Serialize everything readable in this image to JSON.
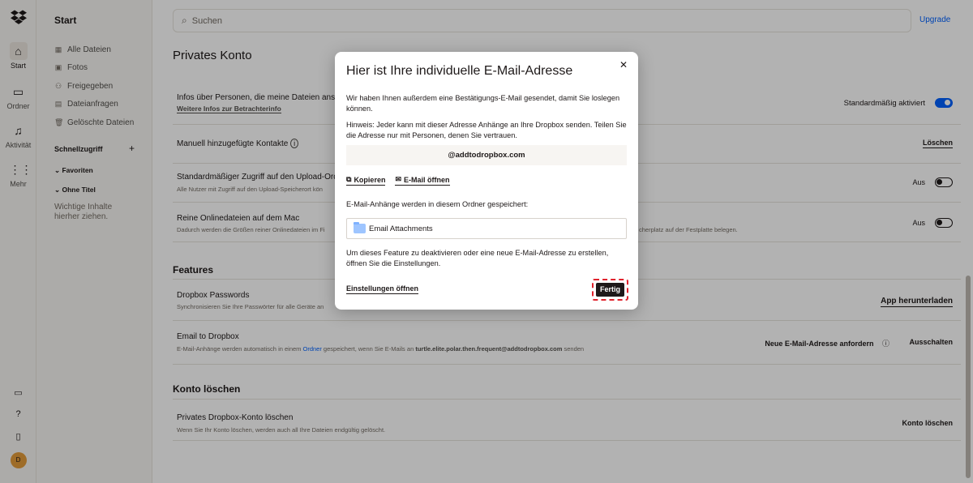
{
  "rail": {
    "items": [
      {
        "label": "Start"
      },
      {
        "label": "Ordner"
      },
      {
        "label": "Aktivität"
      },
      {
        "label": "Mehr"
      }
    ],
    "avatar": "D"
  },
  "sidebar": {
    "title": "Start",
    "items": [
      "Alle Dateien",
      "Fotos",
      "Freigegeben",
      "Dateianfragen",
      "Gelöschte Dateien"
    ],
    "quick_access": "Schnellzugriff",
    "favorites": "Favoriten",
    "untitled": "Ohne Titel",
    "drop_hint_1": "Wichtige Inhalte",
    "drop_hint_2": "hierher ziehen."
  },
  "search": {
    "placeholder": "Suchen"
  },
  "upgrade": "Upgrade",
  "main": {
    "title": "Privates Konto",
    "rows": [
      {
        "title": "Infos über Personen, die meine Dateien anseh",
        "link": "Weitere Infos zur Betrachterinfo",
        "right": "Standardmäßig aktiviert"
      },
      {
        "title": "Manuell hinzugefügte Kontakte",
        "right": "Löschen"
      },
      {
        "title": "Standardmäßiger Zugriff auf den Upload-Ordn",
        "sub": "Alle Nutzer mit Zugriff auf den Upload-Speicherort kön",
        "right": "Aus"
      },
      {
        "title": "Reine Onlinedateien auf dem Mac",
        "sub": "Dadurch werden die Größen reiner Onlinedateien im Fi",
        "sub_right": "cherplatz auf der Festplatte belegen.",
        "right": "Aus"
      }
    ],
    "features_heading": "Features",
    "passwords": {
      "title": "Dropbox Passwords",
      "sub": "Synchronisieren Sie Ihre Passwörter für alle Geräte an",
      "right": "App herunterladen"
    },
    "email": {
      "title": "Email to Dropbox",
      "sub_prefix": "E-Mail-Anhänge werden automatisch in einem ",
      "sub_link": "Ordner",
      "sub_mid": " gespeichert, wenn Sie E-Mails an ",
      "sub_addr": "turtle.elite.polar.then.frequent@addtodropbox.com",
      "sub_suffix": " senden",
      "action1": "Neue E-Mail-Adresse anfordern",
      "action2": "Ausschalten"
    },
    "delete_heading": "Konto löschen",
    "delete": {
      "title": "Privates Dropbox-Konto löschen",
      "sub": "Wenn Sie Ihr Konto löschen, werden auch all Ihre Dateien endgültig gelöscht.",
      "right": "Konto löschen"
    }
  },
  "modal": {
    "title": "Hier ist Ihre individuelle E-Mail-Adresse",
    "p1": "Wir haben Ihnen außerdem eine Bestätigungs-E-Mail gesendet, damit Sie loslegen können.",
    "p2": "Hinweis: Jeder kann mit dieser Adresse Anhänge an Ihre Dropbox senden. Teilen Sie die Adresse nur mit Personen, denen Sie vertrauen.",
    "address": "@addtodropbox.com",
    "copy": "Kopieren",
    "open_mail": "E-Mail öffnen",
    "folder_label": "E-Mail-Anhänge werden in diesem Ordner gespeichert:",
    "folder": "Email Attachments",
    "p3": "Um dieses Feature zu deaktivieren oder eine neue E-Mail-Adresse zu erstellen, öffnen Sie die Einstellungen.",
    "settings_link": "Einstellungen öffnen",
    "done": "Fertig"
  }
}
